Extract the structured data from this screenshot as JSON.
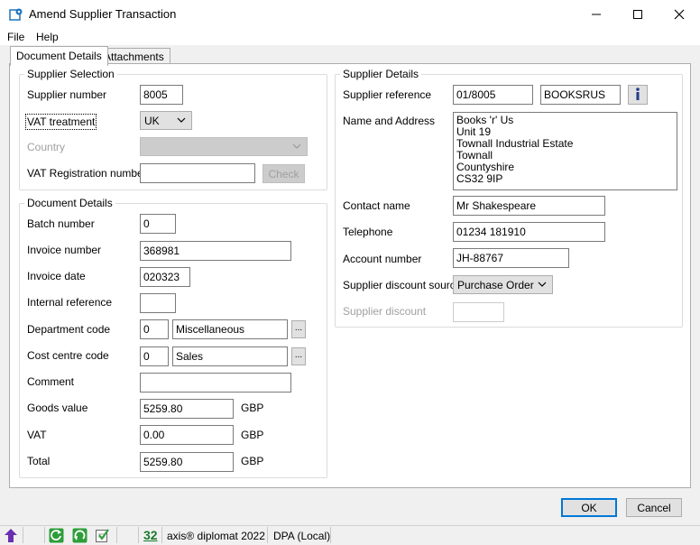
{
  "window": {
    "title": "Amend Supplier Transaction"
  },
  "menu": {
    "file": "File",
    "help": "Help"
  },
  "tabs": {
    "document_details": "Document Details",
    "attachments": "Attachments"
  },
  "supplier_selection": {
    "legend": "Supplier Selection",
    "supplier_number_label": "Supplier number",
    "supplier_number_value": "8005",
    "vat_treatment_label": "VAT treatment",
    "vat_treatment_value": "UK",
    "country_label": "Country",
    "country_value": "",
    "vat_reg_label": "VAT Registration number",
    "vat_reg_value": "",
    "check_label": "Check"
  },
  "document_details": {
    "legend": "Document Details",
    "batch_number_label": "Batch number",
    "batch_number_value": "0",
    "invoice_number_label": "Invoice number",
    "invoice_number_value": "368981",
    "invoice_date_label": "Invoice date",
    "invoice_date_value": "020323",
    "internal_reference_label": "Internal reference",
    "internal_reference_value": "",
    "department_code_label": "Department code",
    "department_code_value": "0",
    "department_name_value": "Miscellaneous",
    "cost_centre_code_label": "Cost centre code",
    "cost_centre_code_value": "0",
    "cost_centre_name_value": "Sales",
    "comment_label": "Comment",
    "comment_value": "",
    "goods_value_label": "Goods value",
    "goods_value_value": "5259.80",
    "vat_label": "VAT",
    "vat_value": "0.00",
    "total_label": "Total",
    "total_value": "5259.80",
    "currency": "GBP",
    "ellipsis": "..."
  },
  "supplier_details": {
    "legend": "Supplier Details",
    "supplier_reference_label": "Supplier reference",
    "supplier_reference_value": "01/8005",
    "supplier_short_name": "BOOKSRUS",
    "info_label": "i",
    "name_address_label": "Name and Address",
    "address_lines": [
      "Books 'r' Us",
      "Unit 19",
      "Townall Industrial Estate",
      "Townall",
      "Countyshire",
      "CS32 9IP"
    ],
    "contact_name_label": "Contact name",
    "contact_name_value": "Mr Shakespeare",
    "telephone_label": "Telephone",
    "telephone_value": "01234 181910",
    "account_number_label": "Account number",
    "account_number_value": "JH-88767",
    "discount_source_label": "Supplier discount source",
    "discount_source_value": "Purchase Order",
    "supplier_discount_label": "Supplier discount",
    "supplier_discount_value": ""
  },
  "buttons": {
    "ok": "OK",
    "cancel": "Cancel"
  },
  "statusbar": {
    "count": "32",
    "product": "axis® diplomat 2022",
    "database": "DPA (Local)"
  },
  "colors": {
    "accent_blue": "#0078d7",
    "green": "#2e9e3a",
    "purple": "#6a2fb0"
  }
}
